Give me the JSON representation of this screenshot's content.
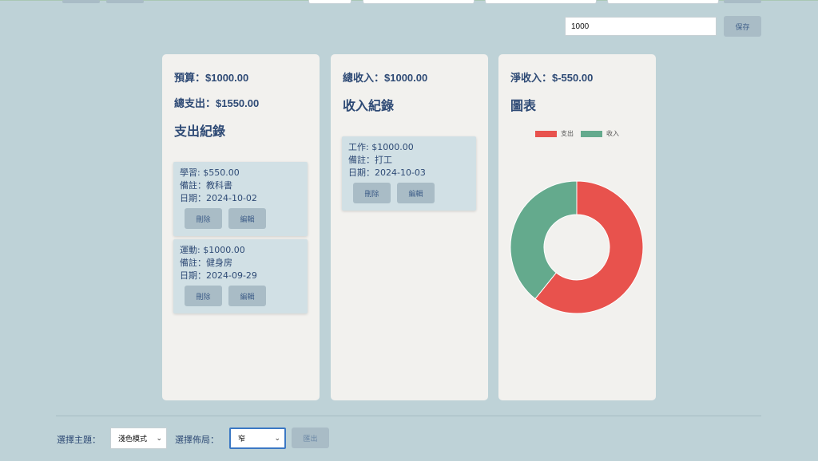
{
  "top": {
    "budget_value": "1000",
    "save_label": "保存"
  },
  "expense_card": {
    "budget_text": "預算：$1000.00",
    "total_expense_text": "總支出：$1550.00",
    "heading": "支出紀錄",
    "records": [
      {
        "title": "學習: $550.00",
        "note": "備註：教科書",
        "date": "日期：2024-10-02",
        "delete_label": "刪除",
        "edit_label": "編輯"
      },
      {
        "title": "運動: $1000.00",
        "note": "備註：健身房",
        "date": "日期：2024-09-29",
        "delete_label": "刪除",
        "edit_label": "編輯"
      }
    ]
  },
  "income_card": {
    "total_income_text": "總收入：$1000.00",
    "heading": "收入紀錄",
    "records": [
      {
        "title": "工作: $1000.00",
        "note": "備註：打工",
        "date": "日期：2024-10-03",
        "delete_label": "刪除",
        "edit_label": "編輯"
      }
    ]
  },
  "chart_card": {
    "net_income_text": "淨收入：$-550.00",
    "heading": "圖表"
  },
  "chart_data": {
    "type": "pie",
    "title": "",
    "categories": [
      "支出",
      "收入"
    ],
    "values": [
      1550,
      1000
    ],
    "colors": [
      "#e8524d",
      "#64aa8d"
    ],
    "legend_position": "top"
  },
  "footer": {
    "theme_label": "選擇主題：",
    "theme_value": "淺色模式",
    "layout_label": "選擇佈局：",
    "layout_value": "窄",
    "export_label": "匯出"
  }
}
